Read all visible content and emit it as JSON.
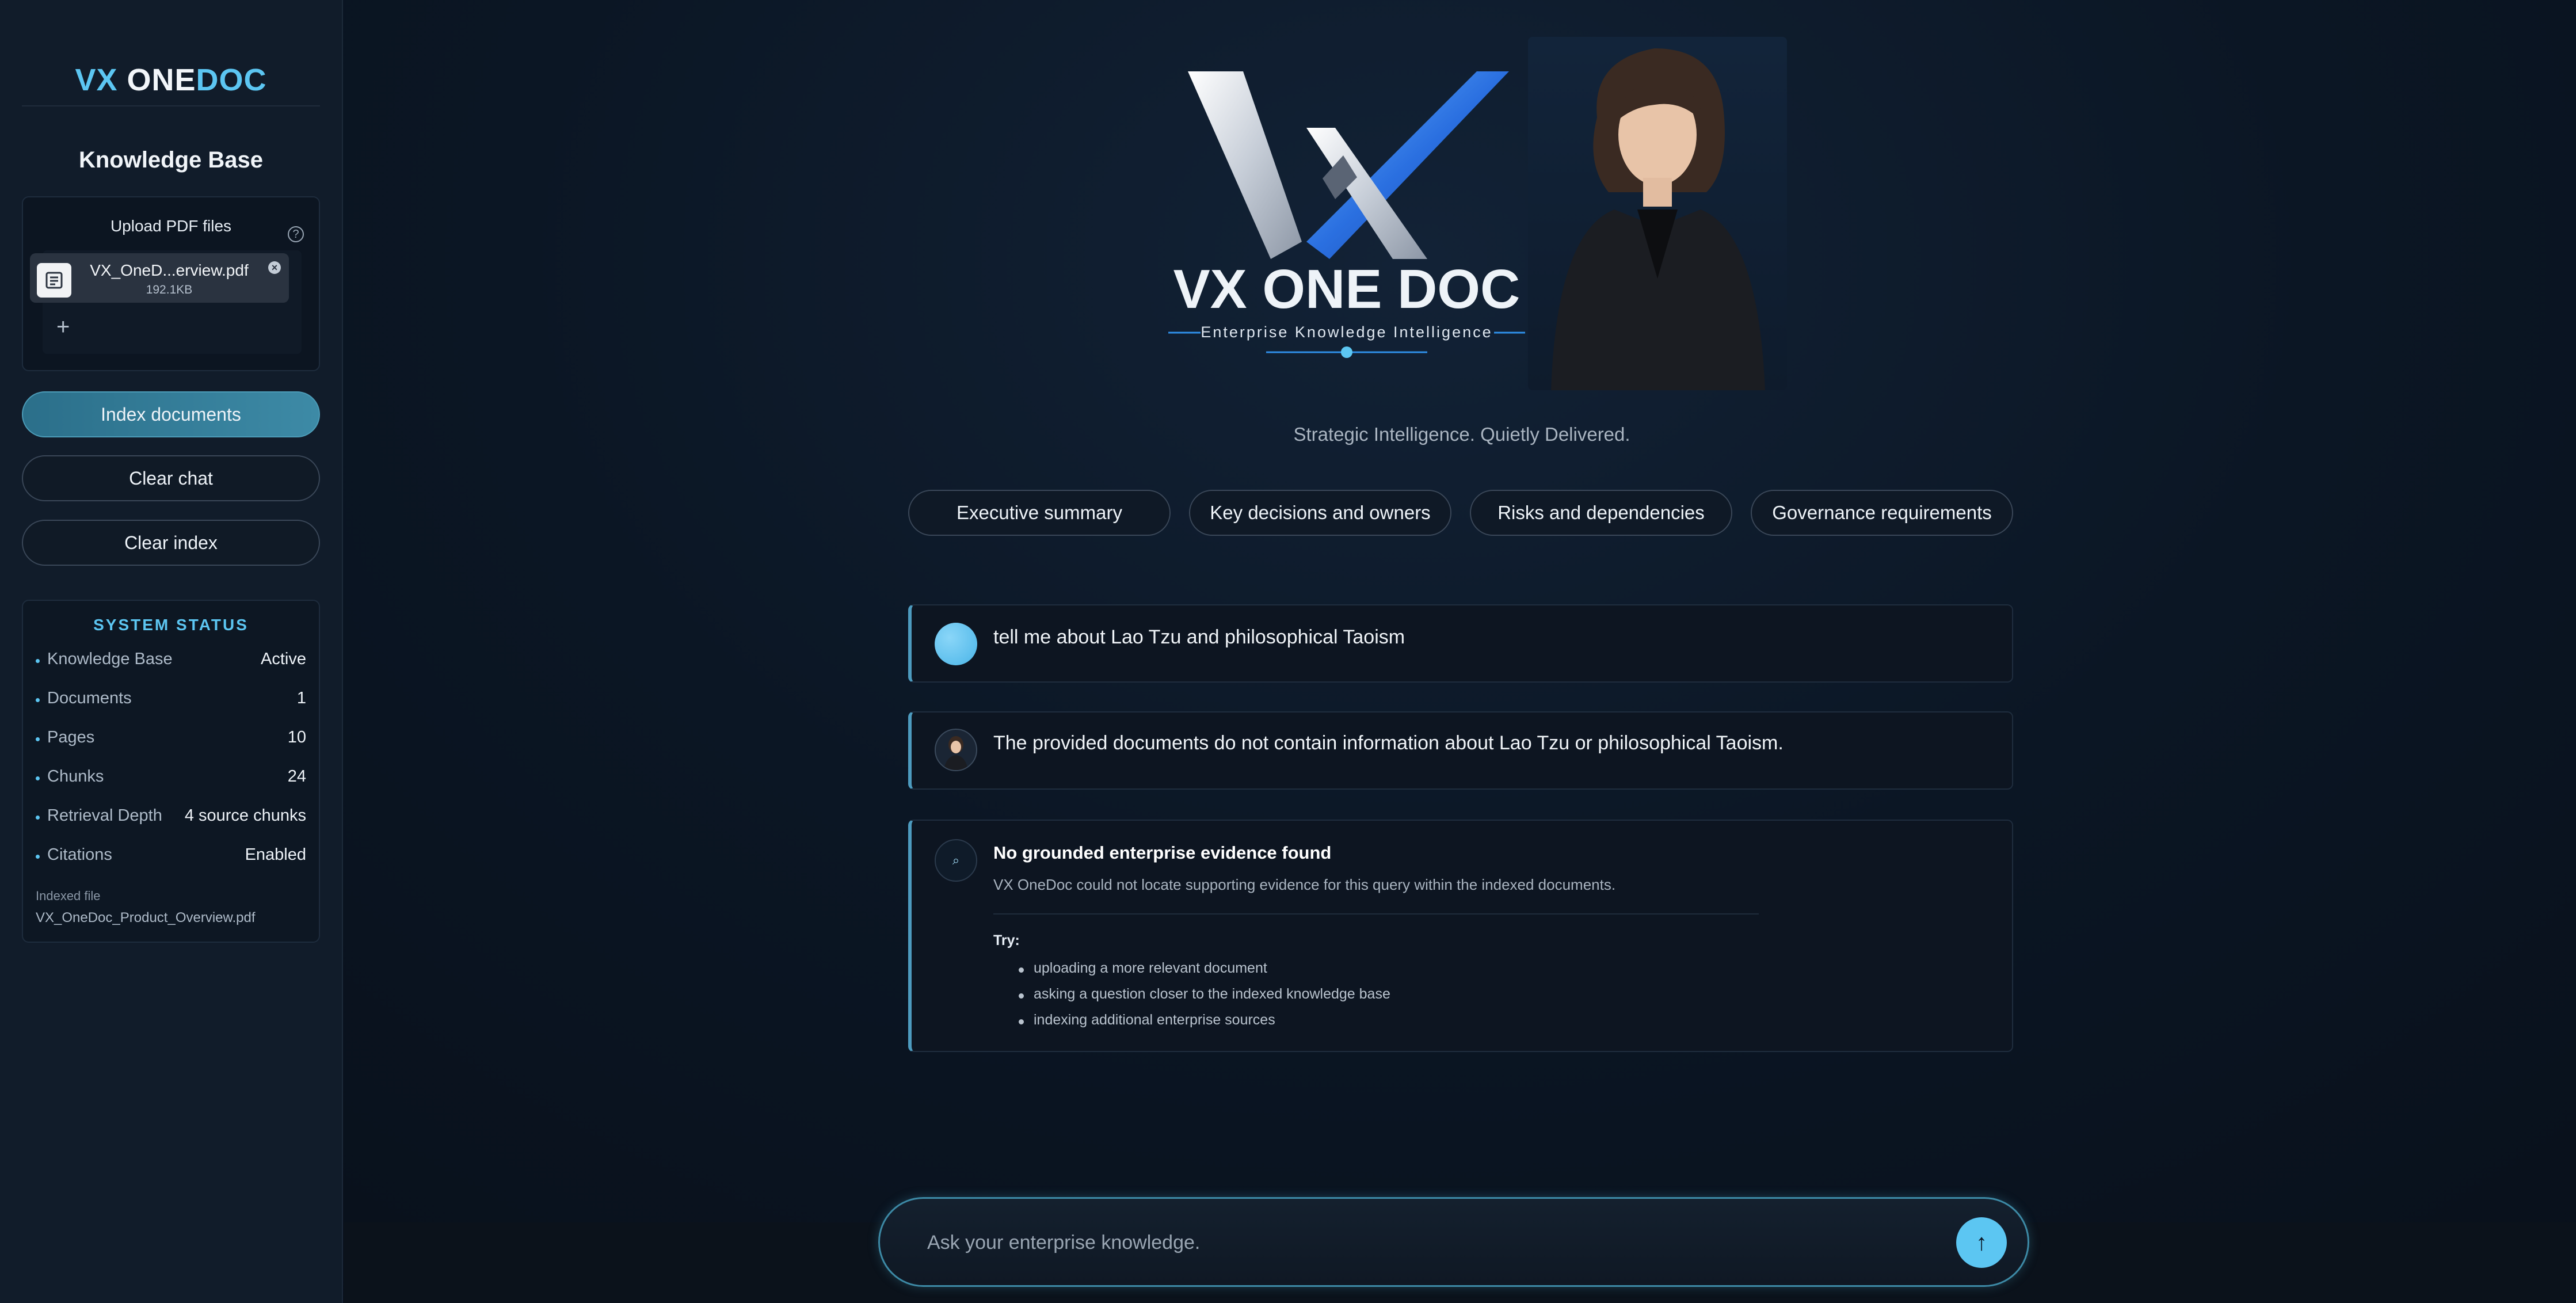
{
  "sidebar": {
    "brand": {
      "vx": "VX",
      "one": "ONE",
      "doc": "DOC"
    },
    "title": "Knowledge Base",
    "upload": {
      "label": "Upload PDF files",
      "help_icon": "help-circle-icon",
      "file": {
        "name": "VX_OneD...erview.pdf",
        "size": "192.1KB"
      },
      "add_icon": "plus-icon"
    },
    "buttons": {
      "index": "Index documents",
      "clear_chat": "Clear chat",
      "clear_index": "Clear index"
    },
    "status": {
      "title": "SYSTEM STATUS",
      "rows": [
        {
          "label": "Knowledge Base",
          "value": "Active"
        },
        {
          "label": "Documents",
          "value": "1"
        },
        {
          "label": "Pages",
          "value": "10"
        },
        {
          "label": "Chunks",
          "value": "24"
        },
        {
          "label": "Retrieval Depth",
          "value": "4 source chunks"
        },
        {
          "label": "Citations",
          "value": "Enabled"
        }
      ],
      "indexed_label": "Indexed file",
      "indexed_file": "VX_OneDoc_Product_Overview.pdf"
    }
  },
  "hero": {
    "logo_line1": "VX ONE DOC",
    "logo_line2": "Enterprise Knowledge Intelligence",
    "tagline": "Strategic Intelligence. Quietly Delivered."
  },
  "quick_prompts": [
    "Executive summary",
    "Key decisions and owners",
    "Risks and dependencies",
    "Governance requirements"
  ],
  "messages": {
    "user": "tell me about Lao Tzu and philosophical Taoism",
    "assistant": "The provided documents do not contain information about Lao Tzu or philosophical Taoism.",
    "notice": {
      "title": "No grounded enterprise evidence found",
      "subtitle": "VX OneDoc could not locate supporting evidence for this query within the indexed documents.",
      "try_label": "Try:",
      "items": [
        "uploading a more relevant document",
        "asking a question closer to the indexed knowledge base",
        "indexing additional enterprise sources"
      ]
    }
  },
  "chat_input": {
    "placeholder": "Ask your enterprise knowledge.",
    "send_icon": "arrow-up-icon"
  },
  "colors": {
    "accent": "#5cc6f2",
    "primary_button": "#3d8aa6",
    "background": "#0b1624"
  }
}
